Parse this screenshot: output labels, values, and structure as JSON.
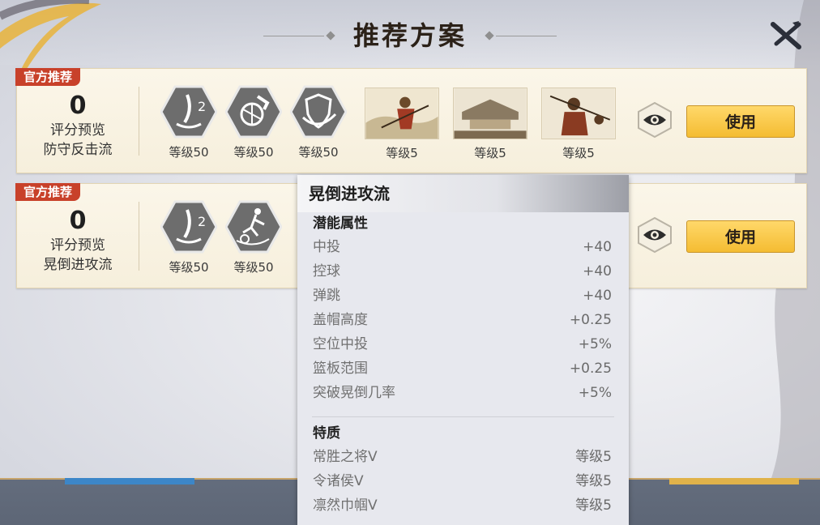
{
  "title": "推荐方案",
  "cards": [
    {
      "badge": "官方推荐",
      "score": "0",
      "score_label": "评分预览",
      "plan_name": "防守反击流",
      "skills": [
        {
          "level": "等级50",
          "icon": "ball-bounce-icon"
        },
        {
          "level": "等级50",
          "icon": "basketball-hand-icon"
        },
        {
          "level": "等级50",
          "icon": "shield-icon"
        }
      ],
      "heroes": [
        {
          "level": "等级5"
        },
        {
          "level": "等级5"
        },
        {
          "level": "等级5"
        }
      ],
      "use_label": "使用"
    },
    {
      "badge": "官方推荐",
      "score": "0",
      "score_label": "评分预览",
      "plan_name": "晃倒进攻流",
      "skills": [
        {
          "level": "等级50",
          "icon": "ball-bounce-icon"
        },
        {
          "level": "等级50",
          "icon": "dribble-player-icon"
        }
      ],
      "use_label": "使用"
    }
  ],
  "popup": {
    "title": "晃倒进攻流",
    "potential_title": "潜能属性",
    "attributes": [
      {
        "name": "中投",
        "value": "+40"
      },
      {
        "name": "控球",
        "value": "+40"
      },
      {
        "name": "弹跳",
        "value": "+40"
      },
      {
        "name": "盖帽高度",
        "value": "+0.25"
      },
      {
        "name": "空位中投",
        "value": "+5%"
      },
      {
        "name": "篮板范围",
        "value": "+0.25"
      },
      {
        "name": "突破晃倒几率",
        "value": "+5%"
      }
    ],
    "traits_title": "特质",
    "traits": [
      {
        "name": "常胜之将Ⅴ",
        "value": "等级5"
      },
      {
        "name": "令诸侯Ⅴ",
        "value": "等级5"
      },
      {
        "name": "凛然巾帼Ⅴ",
        "value": "等级5"
      }
    ]
  }
}
